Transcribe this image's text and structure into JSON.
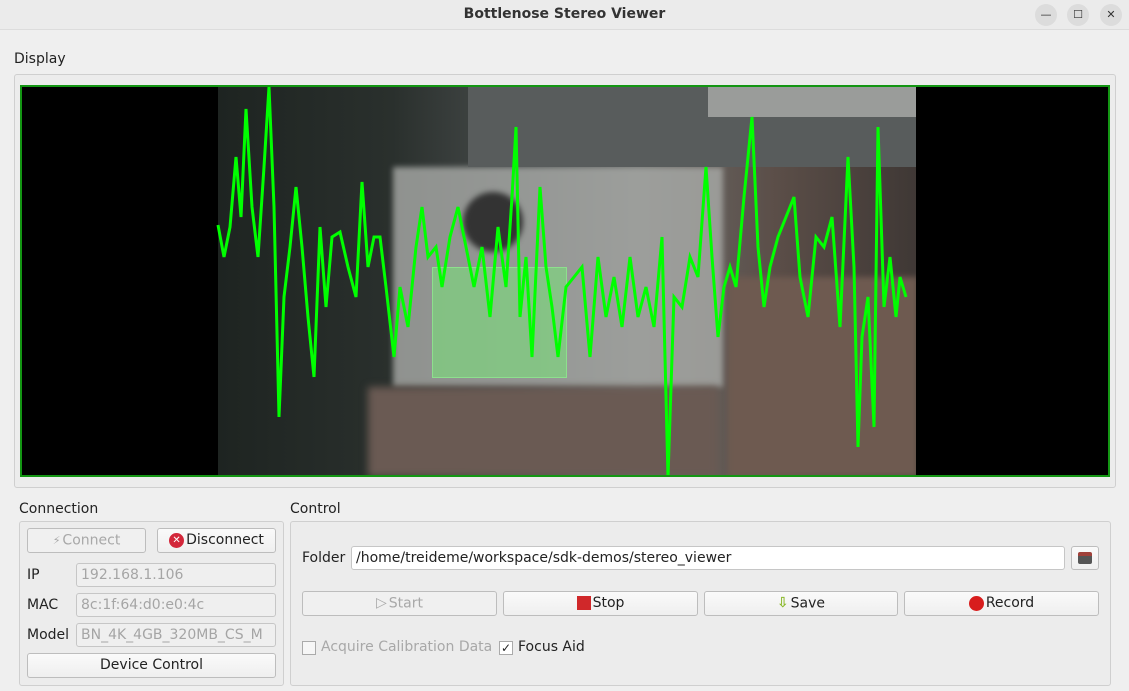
{
  "window": {
    "title": "Bottlenose Stereo Viewer"
  },
  "display": {
    "label": "Display",
    "overlay_color": "#00ff00",
    "frame_color": "#139613"
  },
  "connection": {
    "label": "Connection",
    "connect_label": "Connect",
    "disconnect_label": "Disconnect",
    "ip_label": "IP",
    "ip_value": "192.168.1.106",
    "mac_label": "MAC",
    "mac_value": "8c:1f:64:d0:e0:4c",
    "model_label": "Model",
    "model_value": "BN_4K_4GB_320MB_CS_M",
    "device_control_label": "Device Control"
  },
  "control": {
    "label": "Control",
    "folder_label": "Folder",
    "folder_value": "/home/treideme/workspace/sdk-demos/stereo_viewer",
    "start_label": "Start",
    "stop_label": "Stop",
    "save_label": "Save",
    "record_label": "Record",
    "acquire_calibration_label": "Acquire Calibration Data",
    "acquire_calibration_checked": false,
    "focus_aid_label": "Focus Aid",
    "focus_aid_checked": true
  }
}
